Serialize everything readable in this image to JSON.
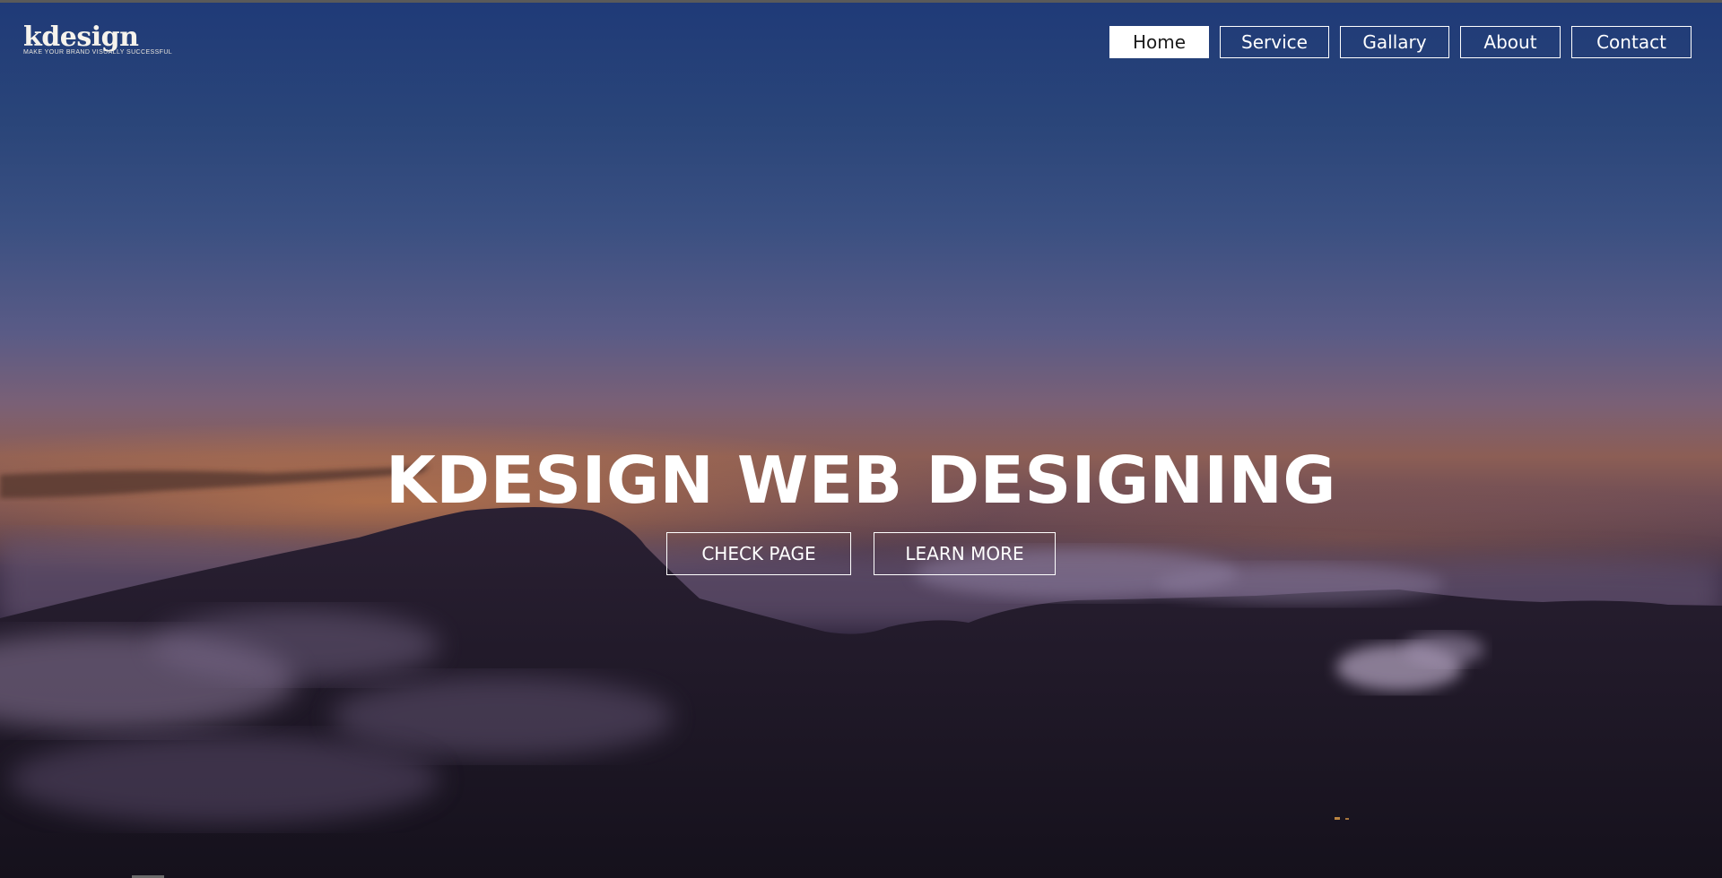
{
  "brand": {
    "logo_text": "kdesign",
    "tagline": "MAKE YOUR BRAND VISUALLY SUCCESSFUL"
  },
  "nav": {
    "items": [
      {
        "label": "Home",
        "active": true
      },
      {
        "label": "Service",
        "active": false
      },
      {
        "label": "Gallary",
        "active": false
      },
      {
        "label": "About",
        "active": false
      },
      {
        "label": "Contact",
        "active": false
      }
    ]
  },
  "hero": {
    "headline": "KDESIGN WEB DESIGNING",
    "primary_button": "CHECK PAGE",
    "secondary_button": "LEARN MORE"
  },
  "colors": {
    "sky_top": "#1f3a78",
    "horizon": "#8c5e55",
    "ground": "#17131f",
    "accent_white": "#ffffff",
    "logo_dot": "#f2b92a"
  }
}
